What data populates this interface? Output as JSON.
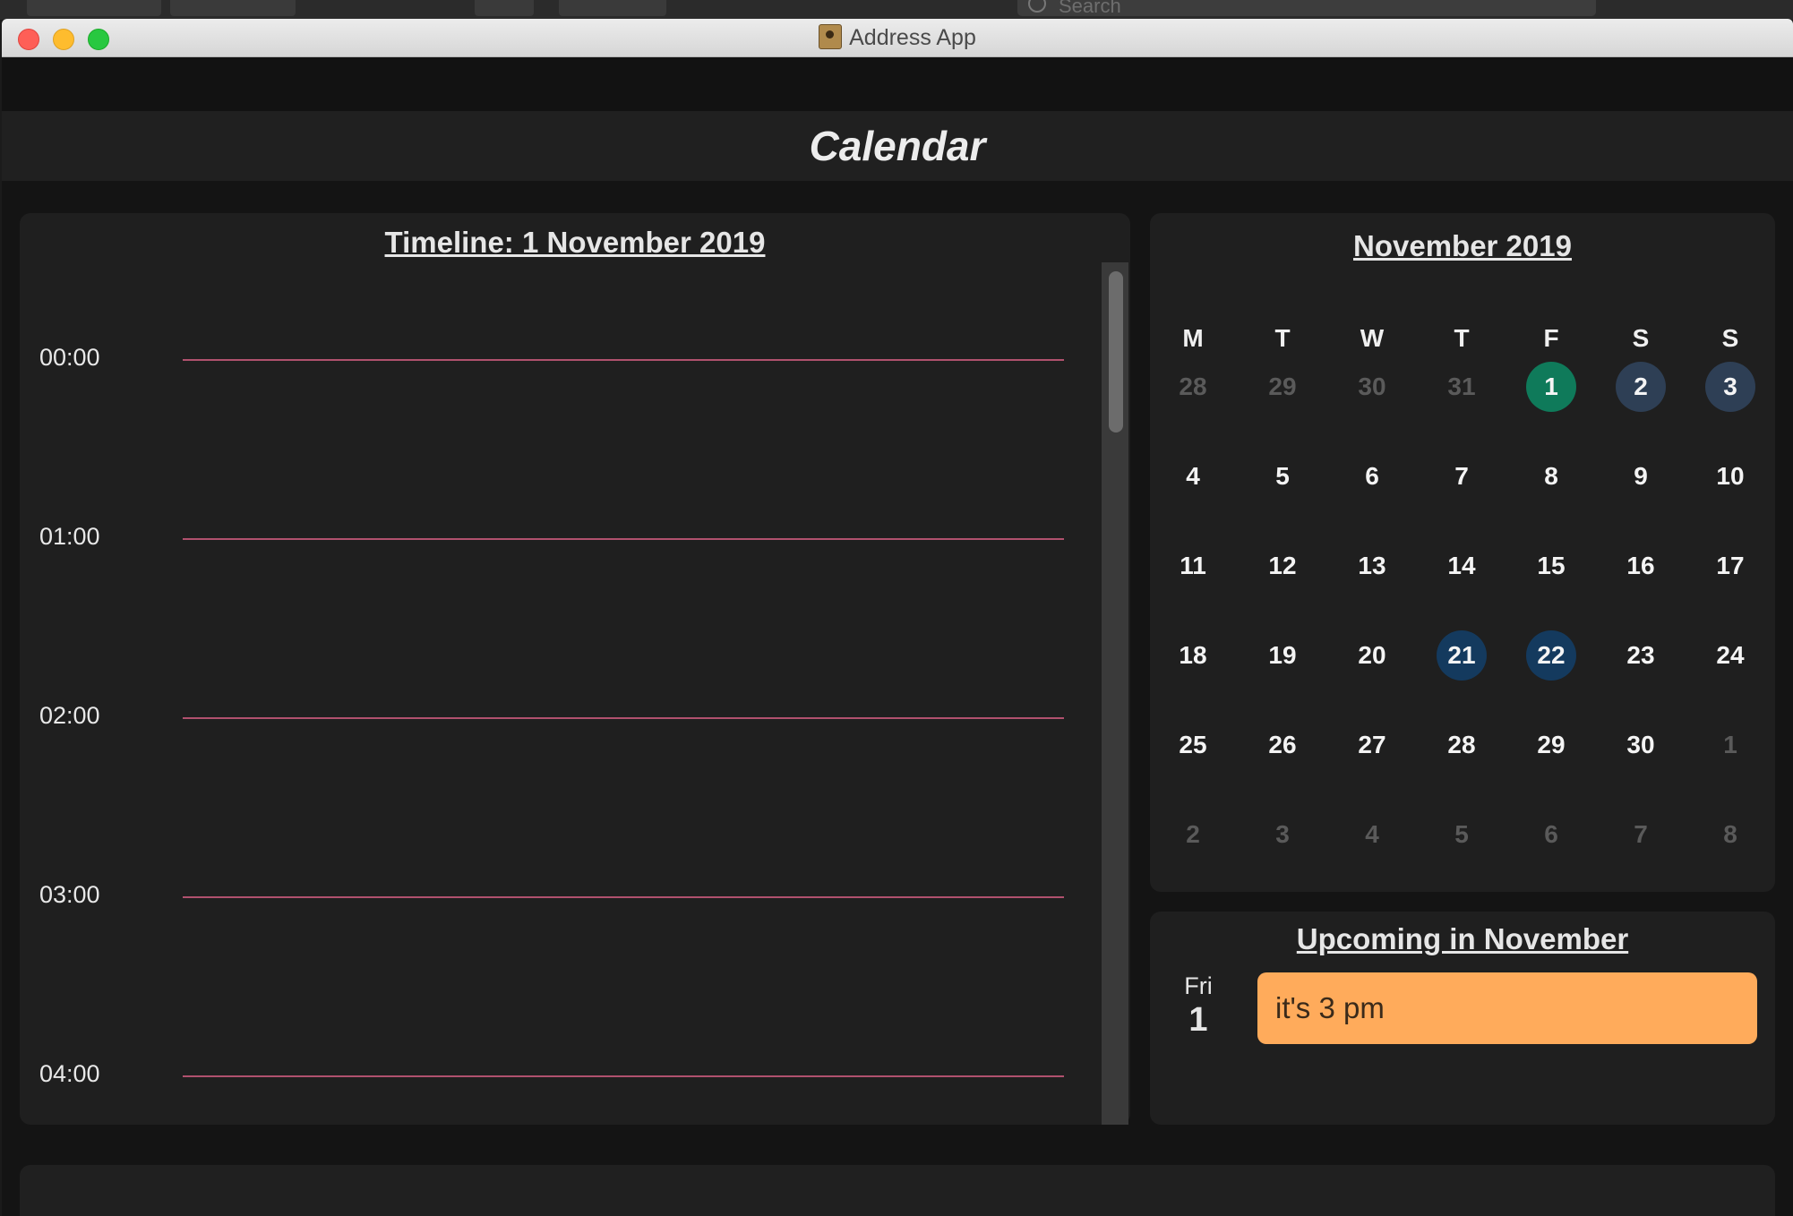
{
  "window": {
    "title": "Address App"
  },
  "desktop": {
    "search_placeholder": "Search"
  },
  "page": {
    "title": "Calendar"
  },
  "timeline": {
    "title": "Timeline: 1 November 2019",
    "hours": [
      "00:00",
      "01:00",
      "02:00",
      "03:00",
      "04:00"
    ]
  },
  "calendar": {
    "title": "November 2019",
    "weekdays": [
      "M",
      "T",
      "W",
      "T",
      "F",
      "S",
      "S"
    ],
    "weeks": [
      [
        "28",
        "29",
        "30",
        "31",
        "1",
        "2",
        "3"
      ],
      [
        "4",
        "5",
        "6",
        "7",
        "8",
        "9",
        "10"
      ],
      [
        "11",
        "12",
        "13",
        "14",
        "15",
        "16",
        "17"
      ],
      [
        "18",
        "19",
        "20",
        "21",
        "22",
        "23",
        "24"
      ],
      [
        "25",
        "26",
        "27",
        "28",
        "29",
        "30",
        "1"
      ],
      [
        "2",
        "3",
        "4",
        "5",
        "6",
        "7",
        "8"
      ]
    ],
    "colors": {
      "selected": "#0f7a5a",
      "weekend_highlight": "#2e3f55",
      "event_highlight": "#143a5e",
      "outside_month": "#5a5a5a"
    }
  },
  "upcoming": {
    "title": "Upcoming in November",
    "events": [
      {
        "weekday": "Fri",
        "day": "1",
        "text": "it's 3 pm",
        "color": "#ffab5b"
      }
    ]
  }
}
